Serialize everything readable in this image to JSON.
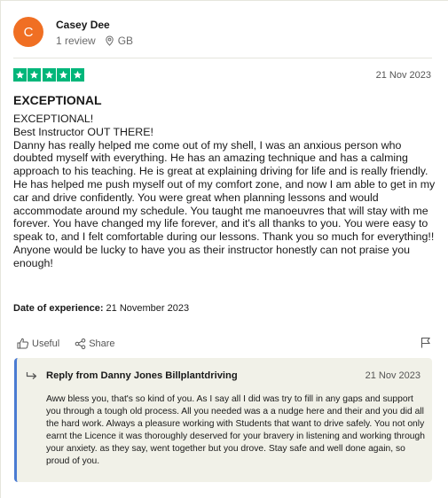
{
  "reviewer": {
    "avatar_letter": "C",
    "avatar_color": "#f06f23",
    "name": "Casey Dee",
    "review_count": "1 review",
    "country": "GB"
  },
  "review": {
    "rating": 5,
    "star_color": "#00b67a",
    "date": "21 Nov 2023",
    "title": "EXCEPTIONAL",
    "body_lines": [
      "EXCEPTIONAL!",
      "Best Instructor OUT THERE!",
      "Danny has really helped me come out of my shell, I was an anxious person who doubted myself with everything. He has an amazing technique and has a calming approach to his teaching. He is great at explaining driving for life and is really friendly. He has helped me push myself out of my comfort zone, and now I am able to get in my car and drive confidently. You were great when planning lessons and would accommodate around my schedule. You taught me manoeuvres that will stay with me forever. You have changed my life forever, and it's all thanks to you. You were easy to speak to, and I felt comfortable during our lessons. Thank you so much for everything!! Anyone would be lucky to have you as their instructor honestly can not praise you enough!"
    ],
    "experience_label": "Date of experience:",
    "experience_date": "21 November 2023"
  },
  "actions": {
    "useful_label": "Useful",
    "share_label": "Share"
  },
  "reply": {
    "from_label": "Reply from Danny Jones Billplantdriving",
    "date": "21 Nov 2023",
    "text": "Aww bless you, that's so kind of you. As I say all I did was try to fill in any gaps and support you through a tough old process. All you needed was a a nudge here and their and you did all the hard work. Always a pleasure working with Students that want to drive safely. You not only earnt the Licence it was thoroughly deserved for your bravery in listening and working through your anxiety. as they say, went together but you drove. Stay safe and well done again, so proud of you.",
    "accent_color": "#4a7bd2",
    "background_color": "#f1f1e8"
  }
}
